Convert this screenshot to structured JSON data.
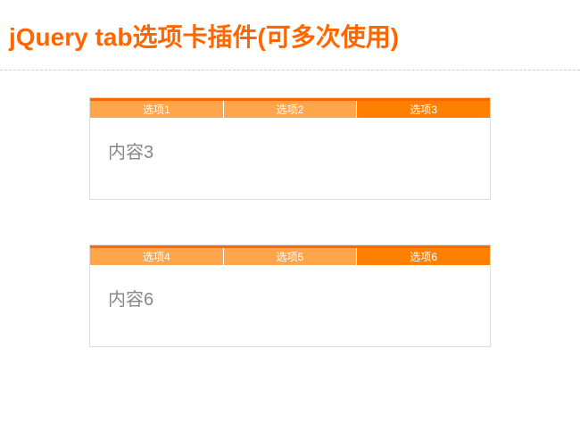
{
  "header": {
    "title": "jQuery tab选项卡插件(可多次使用)"
  },
  "widgets": [
    {
      "tabs": [
        {
          "label": "选项1",
          "active": false
        },
        {
          "label": "选项2",
          "active": false
        },
        {
          "label": "选项3",
          "active": true
        }
      ],
      "content": "内容3"
    },
    {
      "tabs": [
        {
          "label": "选项4",
          "active": false
        },
        {
          "label": "选项5",
          "active": false
        },
        {
          "label": "选项6",
          "active": true
        }
      ],
      "content": "内容6"
    }
  ]
}
